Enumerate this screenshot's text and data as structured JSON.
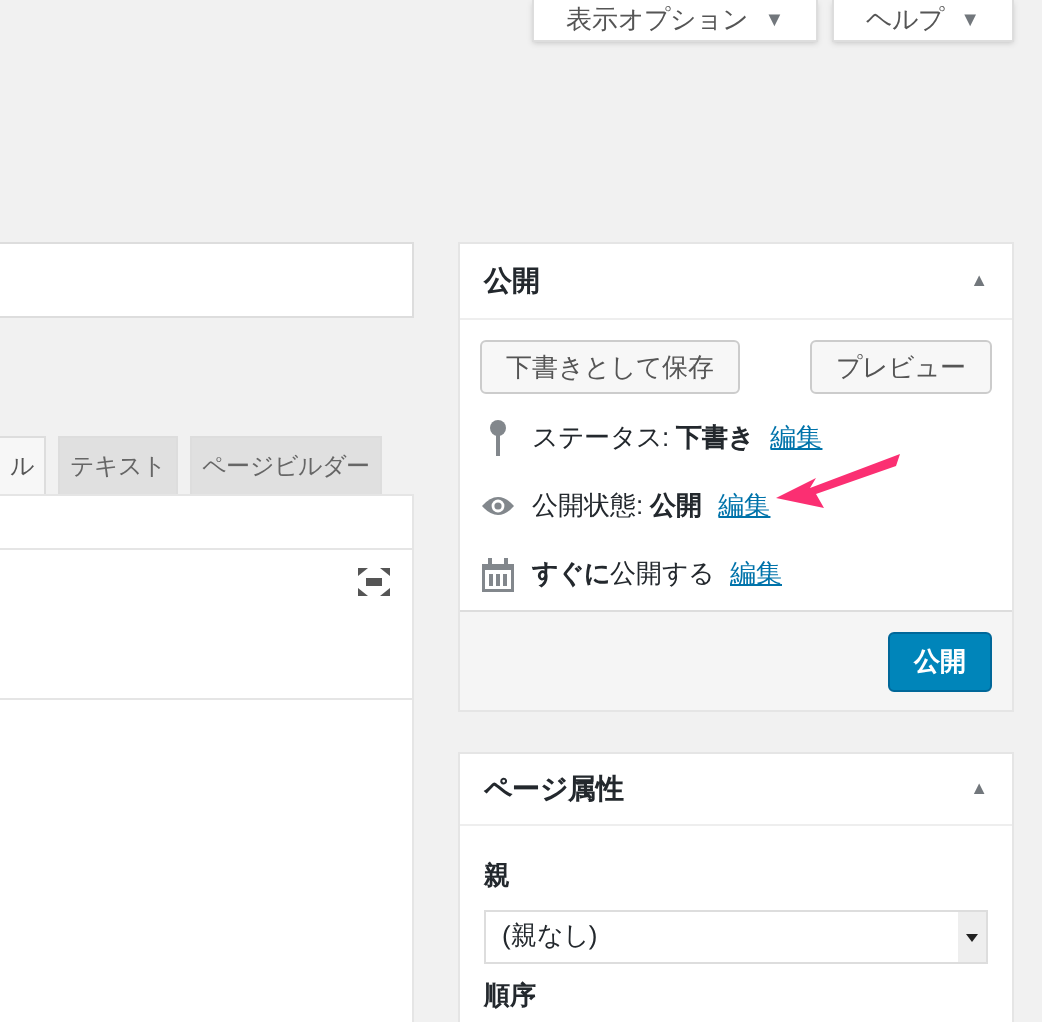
{
  "screen_buttons": [
    {
      "label": "表示オプション",
      "caret": "▼"
    },
    {
      "label": "ヘルプ",
      "caret": "▼"
    }
  ],
  "editor": {
    "tabs": [
      {
        "label": "ル",
        "selected": true
      },
      {
        "label": "テキスト",
        "selected": false
      },
      {
        "label": "ページビルダー",
        "selected": false
      }
    ]
  },
  "publish_box": {
    "title": "公開",
    "toggle": "▲",
    "save_draft": "下書きとして保存",
    "preview": "プレビュー",
    "rows": [
      {
        "kind": "pin",
        "label": "ステータス: ",
        "value": "下書き",
        "link": "編集"
      },
      {
        "kind": "eye",
        "label": "公開状態: ",
        "value": "公開",
        "link": "編集",
        "annotated": true
      },
      {
        "kind": "calendar",
        "label": "",
        "value": "すぐに",
        "suffix": "公開する",
        "link": "編集"
      }
    ],
    "publish": "公開"
  },
  "attributes_box": {
    "title": "ページ属性",
    "toggle": "▲",
    "parent_label": "親",
    "parent_value": "(親なし)",
    "order_label": "順序"
  }
}
